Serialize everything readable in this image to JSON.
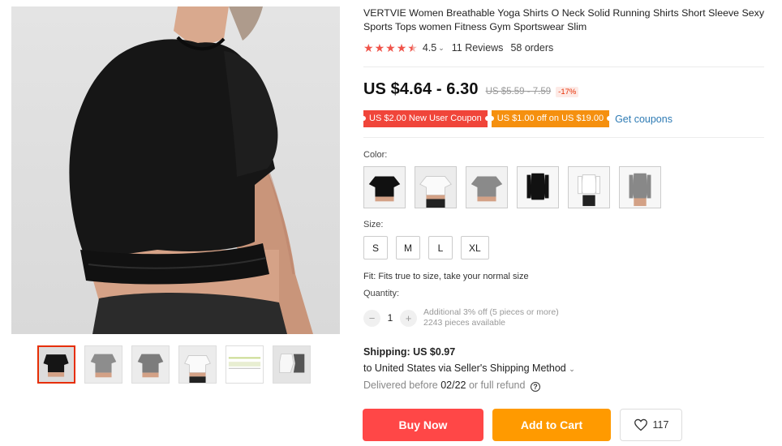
{
  "product": {
    "title": "VERTVIE Women Breathable Yoga Shirts O Neck Solid Running Shirts Short Sleeve Sexy Sports Tops women Fitness Gym Sportswear Slim"
  },
  "rating": {
    "stars": 4.5,
    "value": "4.5",
    "reviews": "11 Reviews",
    "orders": "58 orders"
  },
  "price": {
    "current": "US $4.64 - 6.30",
    "original": "US $5.59 - 7.59",
    "discount": "-17%"
  },
  "coupons": {
    "new_user": "US $2.00 New User Coupon",
    "store": "US $1.00 off on US $19.00",
    "get_link": "Get coupons"
  },
  "color": {
    "label": "Color:",
    "options": [
      "black-short-sleeve",
      "white-short-sleeve",
      "gray-short-sleeve",
      "black-long-sleeve",
      "white-long-sleeve",
      "gray-long-sleeve"
    ]
  },
  "size": {
    "label": "Size:",
    "options": [
      "S",
      "M",
      "L",
      "XL"
    ]
  },
  "fit": "Fit: Fits true to size, take your normal size",
  "quantity": {
    "label": "Quantity:",
    "minus": "−",
    "plus": "+",
    "value": "1",
    "additional": "Additional 3% off (5 pieces or more)",
    "available": "2243 pieces available"
  },
  "shipping": {
    "title": "Shipping: US $0.97",
    "destination": "to United States via Seller's Shipping Method",
    "delivered_prefix": "Delivered before ",
    "delivered_date": "02/22",
    "delivered_suffix": " or full refund"
  },
  "actions": {
    "buy_now": "Buy Now",
    "add_to_cart": "Add to Cart",
    "wishlist_count": "117"
  },
  "colors": {
    "accent": "#ff4747",
    "cart": "#ff9a00",
    "link": "#2e7bb4",
    "star": "#f0544a"
  }
}
